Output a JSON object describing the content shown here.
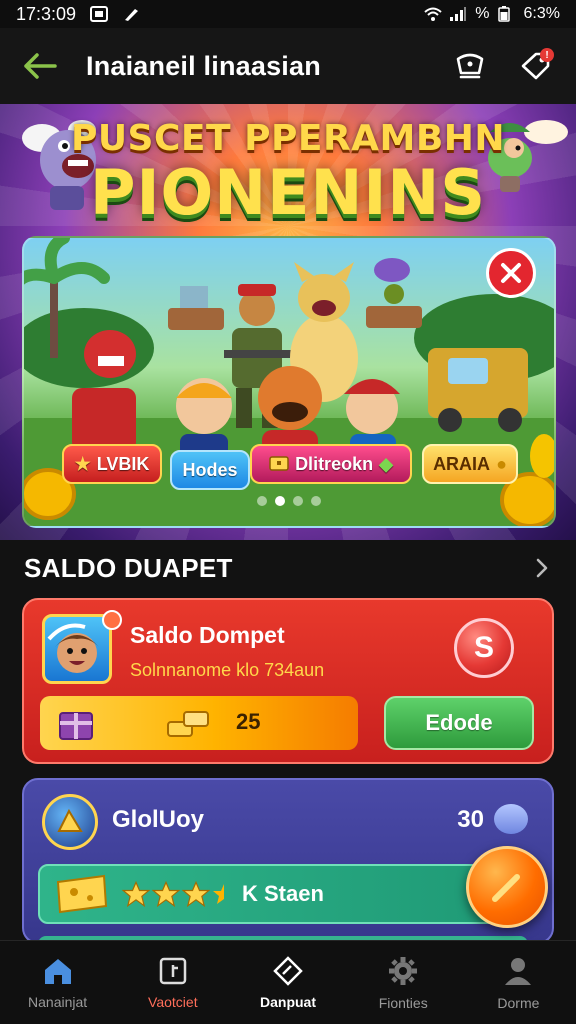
{
  "status_bar": {
    "time": "17:3:09",
    "battery_text": "%",
    "battery_value": "6:3%"
  },
  "app_bar": {
    "title": "Inaianeil linaasian"
  },
  "hero": {
    "title_line1": "PUSCET PPERAMBHN",
    "title_line2": "PIONENINS",
    "chips": [
      {
        "label": "LVBIK"
      },
      {
        "label": "Hodes"
      },
      {
        "label": "Dlitreokn"
      },
      {
        "label": "ARAIA"
      }
    ],
    "carousel_dots": 4,
    "active_dot": 1
  },
  "section": {
    "title": "SALDO DUAPET"
  },
  "wallet_card": {
    "name": "Saldo Dompet",
    "subtitle": "Solnnanome klo 734aun",
    "badge": "S",
    "balance": "25",
    "button_label": "Edode"
  },
  "reward_card": {
    "name": "GlolUoy",
    "value": "30",
    "stars": 3,
    "label": "K Staen",
    "trailing": "0"
  },
  "bottom_nav": {
    "items": [
      {
        "label": "Nanainjat",
        "icon": "home-icon"
      },
      {
        "label": "Vaotciet",
        "icon": "wallet-icon"
      },
      {
        "label": "Danpuat",
        "icon": "diamond-icon"
      },
      {
        "label": "Fionties",
        "icon": "gear-icon"
      },
      {
        "label": "Dorme",
        "icon": "profile-icon"
      }
    ],
    "active_index": 2
  },
  "colors": {
    "accent_green": "#8bc34a",
    "wallet_red": "#d8291f",
    "card_purple": "#3f3f9a",
    "fab_orange": "#ff6d00"
  }
}
